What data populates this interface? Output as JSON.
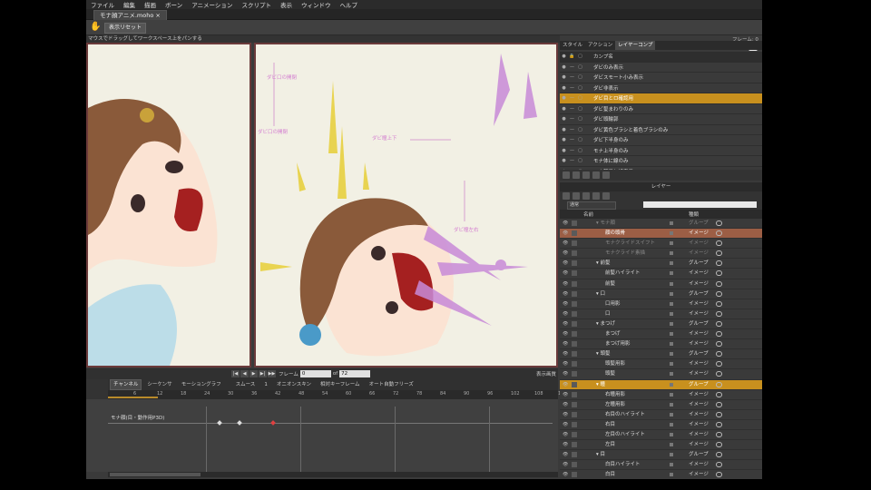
{
  "menu": [
    "ファイル",
    "編集",
    "描画",
    "ボーン",
    "アニメーション",
    "スクリプト",
    "表示",
    "ウィンドウ",
    "ヘルプ"
  ],
  "document_tab": "モナ顔アニメ.moho",
  "toolbar": {
    "reset_label": "表示リセット"
  },
  "hint": "マウスでドラッグしてワークスペース上をパンする",
  "right_info": "フレーム: 0",
  "canvas_labels": {
    "l1": "ダビ口の開閉",
    "l2": "ダビ口の開閉",
    "l3": "ダビ瞳左右",
    "l4": "ダビ瞳上下"
  },
  "transport": {
    "frame_label": "フレーム",
    "frame_value": "0",
    "of_label": "of",
    "total_value": "72",
    "view_label": "表示画質"
  },
  "timeline": {
    "tabs": [
      "チャンネル",
      "シーケンサ",
      "モーショングラフ"
    ],
    "smooth": "スムース",
    "value": "1",
    "onion": "オニオンスキン",
    "relative": "相対キーフレーム",
    "auto_freeze": "オート自動フリーズ",
    "track_label": "モナ顔(目・動作用P3D)",
    "ticks": [
      "6",
      "12",
      "18",
      "24",
      "30",
      "36",
      "42",
      "48",
      "54",
      "60",
      "66",
      "72",
      "78",
      "84",
      "90",
      "96",
      "102",
      "108",
      "114",
      "120",
      "126"
    ]
  },
  "panel_tabs": [
    "スタイル",
    "アクション",
    "レイヤーコンプ"
  ],
  "anim_header": "カンプ名",
  "anim_items": [
    "ダビのみ表示",
    "ダビスモート小み表示",
    "ダビ非表示",
    "ダビ目とロ確認用",
    "ダビ髪まわりのみ",
    "ダビ頭輪郭",
    "ダビ黄色ブラシと着色ブラシのみ",
    "ダビ下半身のみ",
    "モナ上半身のみ",
    "モナ体に線のみ",
    "モナ顔目と線表示"
  ],
  "anim_selected": 3,
  "layers_title": "レイヤー",
  "blend_mode": "通常",
  "layer_columns": {
    "name": "名前",
    "type": "種類"
  },
  "layers": [
    {
      "name": "モナ顔",
      "type": "グループ",
      "indent": 1,
      "state": "dim"
    },
    {
      "name": "顔の頭骨",
      "type": "イメージ",
      "indent": 2,
      "state": "sel2"
    },
    {
      "name": "モナクライドスイフト",
      "type": "イメージ",
      "indent": 2,
      "state": "dim"
    },
    {
      "name": "モナクライド素描",
      "type": "イメージ",
      "indent": 2,
      "state": "dim"
    },
    {
      "name": "前髪",
      "type": "グループ",
      "indent": 1,
      "state": ""
    },
    {
      "name": "前髪ハイライト",
      "type": "イメージ",
      "indent": 2,
      "state": ""
    },
    {
      "name": "前髪",
      "type": "イメージ",
      "indent": 2,
      "state": ""
    },
    {
      "name": "口",
      "type": "グループ",
      "indent": 1,
      "state": ""
    },
    {
      "name": "口用影",
      "type": "イメージ",
      "indent": 2,
      "state": ""
    },
    {
      "name": "口",
      "type": "イメージ",
      "indent": 2,
      "state": ""
    },
    {
      "name": "まつげ",
      "type": "グループ",
      "indent": 1,
      "state": ""
    },
    {
      "name": "まつげ",
      "type": "イメージ",
      "indent": 2,
      "state": ""
    },
    {
      "name": "まつげ用影",
      "type": "イメージ",
      "indent": 2,
      "state": ""
    },
    {
      "name": "頭髪",
      "type": "グループ",
      "indent": 1,
      "state": ""
    },
    {
      "name": "頭髪用影",
      "type": "イメージ",
      "indent": 2,
      "state": ""
    },
    {
      "name": "頭髪",
      "type": "イメージ",
      "indent": 2,
      "state": ""
    },
    {
      "name": "瞳",
      "type": "グループ",
      "indent": 1,
      "state": "sel"
    },
    {
      "name": "右瞳用影",
      "type": "イメージ",
      "indent": 2,
      "state": ""
    },
    {
      "name": "左瞳用影",
      "type": "イメージ",
      "indent": 2,
      "state": ""
    },
    {
      "name": "右目のハイライト",
      "type": "イメージ",
      "indent": 2,
      "state": ""
    },
    {
      "name": "右目",
      "type": "イメージ",
      "indent": 2,
      "state": ""
    },
    {
      "name": "左目のハイライト",
      "type": "イメージ",
      "indent": 2,
      "state": ""
    },
    {
      "name": "左目",
      "type": "イメージ",
      "indent": 2,
      "state": ""
    },
    {
      "name": "目",
      "type": "グループ",
      "indent": 1,
      "state": ""
    },
    {
      "name": "白目ハイライト",
      "type": "イメージ",
      "indent": 2,
      "state": ""
    },
    {
      "name": "白目",
      "type": "イメージ",
      "indent": 2,
      "state": ""
    },
    {
      "name": "目の影",
      "type": "イメージ",
      "indent": 2,
      "state": ""
    }
  ],
  "colors": {
    "accent": "#c8901e",
    "canvas_bg": "#f2f0e4",
    "canvas_border": "#6b3a3a"
  }
}
